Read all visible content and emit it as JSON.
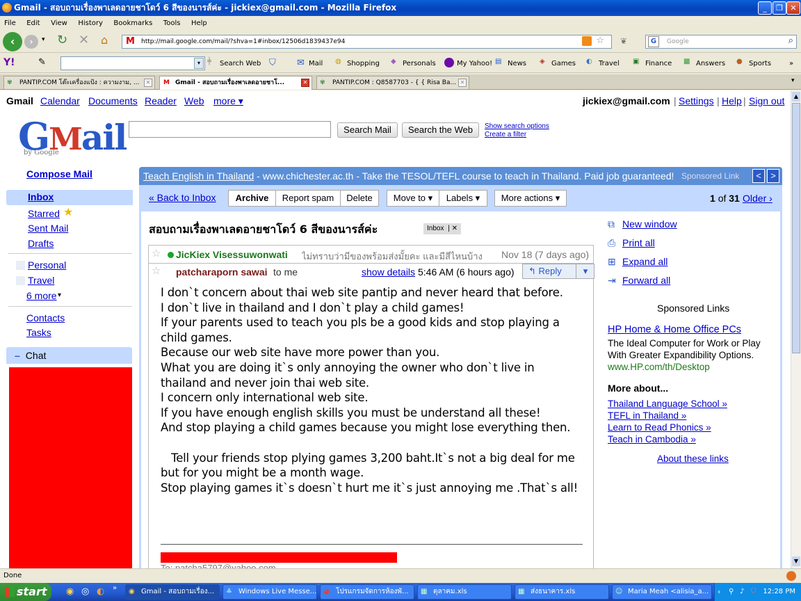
{
  "window": {
    "title": "Gmail - สอบถามเรื่องพาเลดอายชาโดว์ 6 สีของนารส์ค่ะ - jickiex@gmail.com - Mozilla Firefox"
  },
  "menu": [
    "File",
    "Edit",
    "View",
    "History",
    "Bookmarks",
    "Tools",
    "Help"
  ],
  "nav": {
    "url": "http://mail.google.com/mail/?shva=1#inbox/12506d1839437e94",
    "search_placeholder": "Google"
  },
  "yahoo": {
    "items": [
      "Search Web",
      "Mail",
      "Shopping",
      "Personals",
      "My Yahoo!",
      "News",
      "Games",
      "Travel",
      "Finance",
      "Answers",
      "Sports"
    ]
  },
  "tabs": [
    {
      "label": "PANTIP.COM โต๊ะเครื่องแป้ง : ความงาม, ..."
    },
    {
      "label": "Gmail - สอบถามเรื่องพาเลดอายชาโ..."
    },
    {
      "label": "PANTIP.COM : Q8587703 - { { Risa Ba..."
    }
  ],
  "gmail": {
    "topnav": {
      "brand": "Gmail",
      "links": [
        "Calendar",
        "Documents",
        "Reader",
        "Web",
        "more ▾"
      ],
      "account": "jickiex@gmail.com",
      "settings": "Settings",
      "help": "Help",
      "signout": "Sign out"
    },
    "logo": "Gmail",
    "logo_sub": "by Google",
    "search": {
      "search_mail": "Search Mail",
      "search_web": "Search the Web",
      "show_options": "Show search options",
      "create_filter": "Create a filter"
    },
    "sidebar": {
      "compose": "Compose Mail",
      "inbox": "Inbox",
      "starred": "Starred",
      "sent": "Sent Mail",
      "drafts": "Drafts",
      "labels": [
        "Personal",
        "Travel"
      ],
      "more": "6 more",
      "contacts": "Contacts",
      "tasks": "Tasks",
      "chat": "Chat"
    },
    "ad": {
      "link": "Teach English in Thailand",
      "text": " - www.chichester.ac.th - Take the TESOL/TEFL course to teach in Thailand. Paid job guaranteed!",
      "sponsored": "Sponsored Link"
    },
    "actions": {
      "back": "« Back to Inbox",
      "archive": "Archive",
      "spam": "Report spam",
      "delete": "Delete",
      "move": "Move to ▾",
      "labels": "Labels ▾",
      "more": "More actions ▾",
      "pager_pos": "1",
      "pager_of": "of",
      "pager_total": "31",
      "older": "Older ›"
    },
    "thread": {
      "subject": "สอบถามเรื่องพาเลดอายชาโดว์ 6 สีของนารส์ค่ะ",
      "label": "Inbox",
      "first": {
        "sender": "JicKiex Visessuwonwati",
        "snippet": "ไม่ทราบว่ามีของพร้อมส่งมั้ยคะ และมีสีไหนบ้าง",
        "date": "Nov 18 (7 days ago)"
      },
      "second": {
        "sender": "patcharaporn sawai",
        "to": "to me",
        "details": "show details",
        "time": "5:46 AM (6 hours ago)",
        "reply": "Reply"
      },
      "body": [
        "I don`t concern about thai web site pantip and never heard that before.",
        "I don`t live in thailand and I don`t play a child games!",
        "If your parents used to teach you pls be a good kids and stop playing a",
        "child games.",
        "Because our web site have more power than you.",
        "What you are doing it`s only annoying the owner who don`t live in",
        "thailand and never join thai web site.",
        "I concern only international web site.",
        "If you have enough english skills you must be understand all these!",
        "And stop playing a child games because you might lose everything then.",
        "",
        "   Tell your friends stop plying games 3,200 baht.It`s not a big deal for me",
        "but for you might be a month wage.",
        "Stop playing games it`s doesn`t hurt me it`s just annoying me .That`s all!"
      ],
      "footer_partial": "To: patcha5797@yahoo.com"
    },
    "side": {
      "new_window": "New window",
      "print_all": "Print all",
      "expand_all": "Expand all",
      "forward_all": "Forward all",
      "sponsored_title": "Sponsored Links",
      "ad_title": "HP Home & Home Office PCs",
      "ad_text1": "The Ideal Computer for Work or Play",
      "ad_text2": "With Greater Expandibility Options.",
      "ad_url": "www.HP.com/th/Desktop",
      "more_about": "More about...",
      "more_links": [
        "Thailand Language School »",
        "TEFL in Thailand »",
        "Learn to Read Phonics »",
        "Teach in Cambodia »"
      ],
      "about_links": "About these links"
    }
  },
  "status": "Done",
  "taskbar": {
    "start": "start",
    "tasks": [
      "Gmail - สอบถามเรื่อง...",
      "Windows Live Messe...",
      "โปรแกรมจัดการห้องพั...",
      "ตุลาคม.xls",
      "ส่งธนาคาร.xls",
      "Maria Meah <alisia_a..."
    ],
    "clock": "12:28 PM"
  },
  "colors": {
    "gmail_blue": "#c3d9ff",
    "ad_bar": "#5b8fd7",
    "redacted": "#ff0000",
    "xp_taskbar": "#245dd6"
  }
}
